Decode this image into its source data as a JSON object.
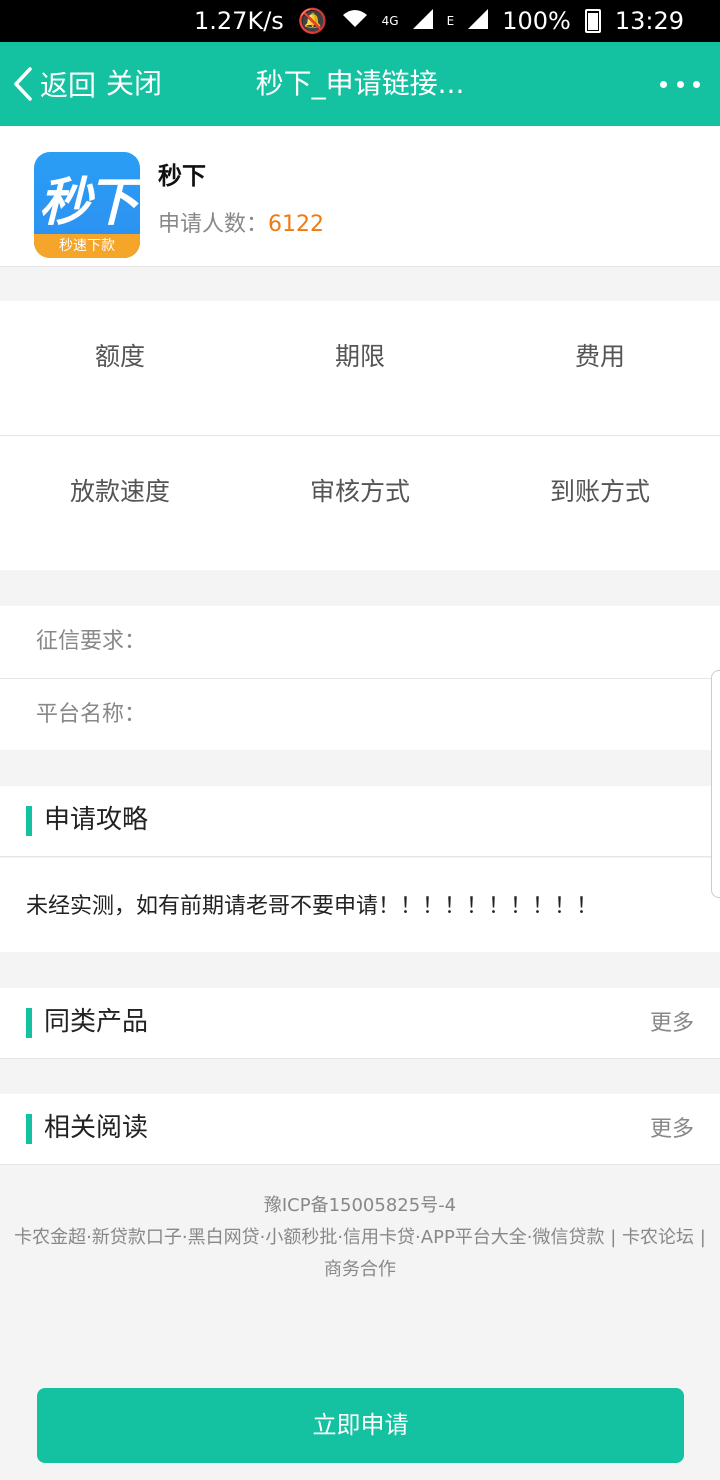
{
  "status_bar": {
    "speed": "1.27K/s",
    "network_4g": "4G",
    "network_e": "E",
    "battery": "100%",
    "time": "13:29"
  },
  "nav": {
    "back_label": "返回",
    "close_label": "关闭",
    "title": "秒下_申请链接...",
    "more_icon": "more-icon"
  },
  "app": {
    "logo_text": "秒下",
    "logo_sub": "秒速下款",
    "name": "秒下",
    "count_label": "申请人数：",
    "count_value": "6122",
    "count_color": "#f07a12"
  },
  "grid": {
    "row1": [
      "额度",
      "期限",
      "费用"
    ],
    "row2": [
      "放款速度",
      "审核方式",
      "到账方式"
    ]
  },
  "info": {
    "credit_label": "征信要求：",
    "platform_label": "平台名称："
  },
  "strategy": {
    "title": "申请攻略",
    "text": "未经实测，如有前期请老哥不要申请！！！！！！！！！！"
  },
  "similar": {
    "title": "同类产品",
    "more": "更多"
  },
  "related": {
    "title": "相关阅读",
    "more": "更多"
  },
  "footer": {
    "icp": "豫ICP备15005825号-4",
    "links": "卡农金超·新贷款口子·黑白网贷·小额秒批·信用卡贷·APP平台大全·微信贷款 | 卡农论坛 | 商务合作"
  },
  "apply_button": "立即申请",
  "colors": {
    "brand": "#14c1a0",
    "accent": "#f07a12"
  }
}
